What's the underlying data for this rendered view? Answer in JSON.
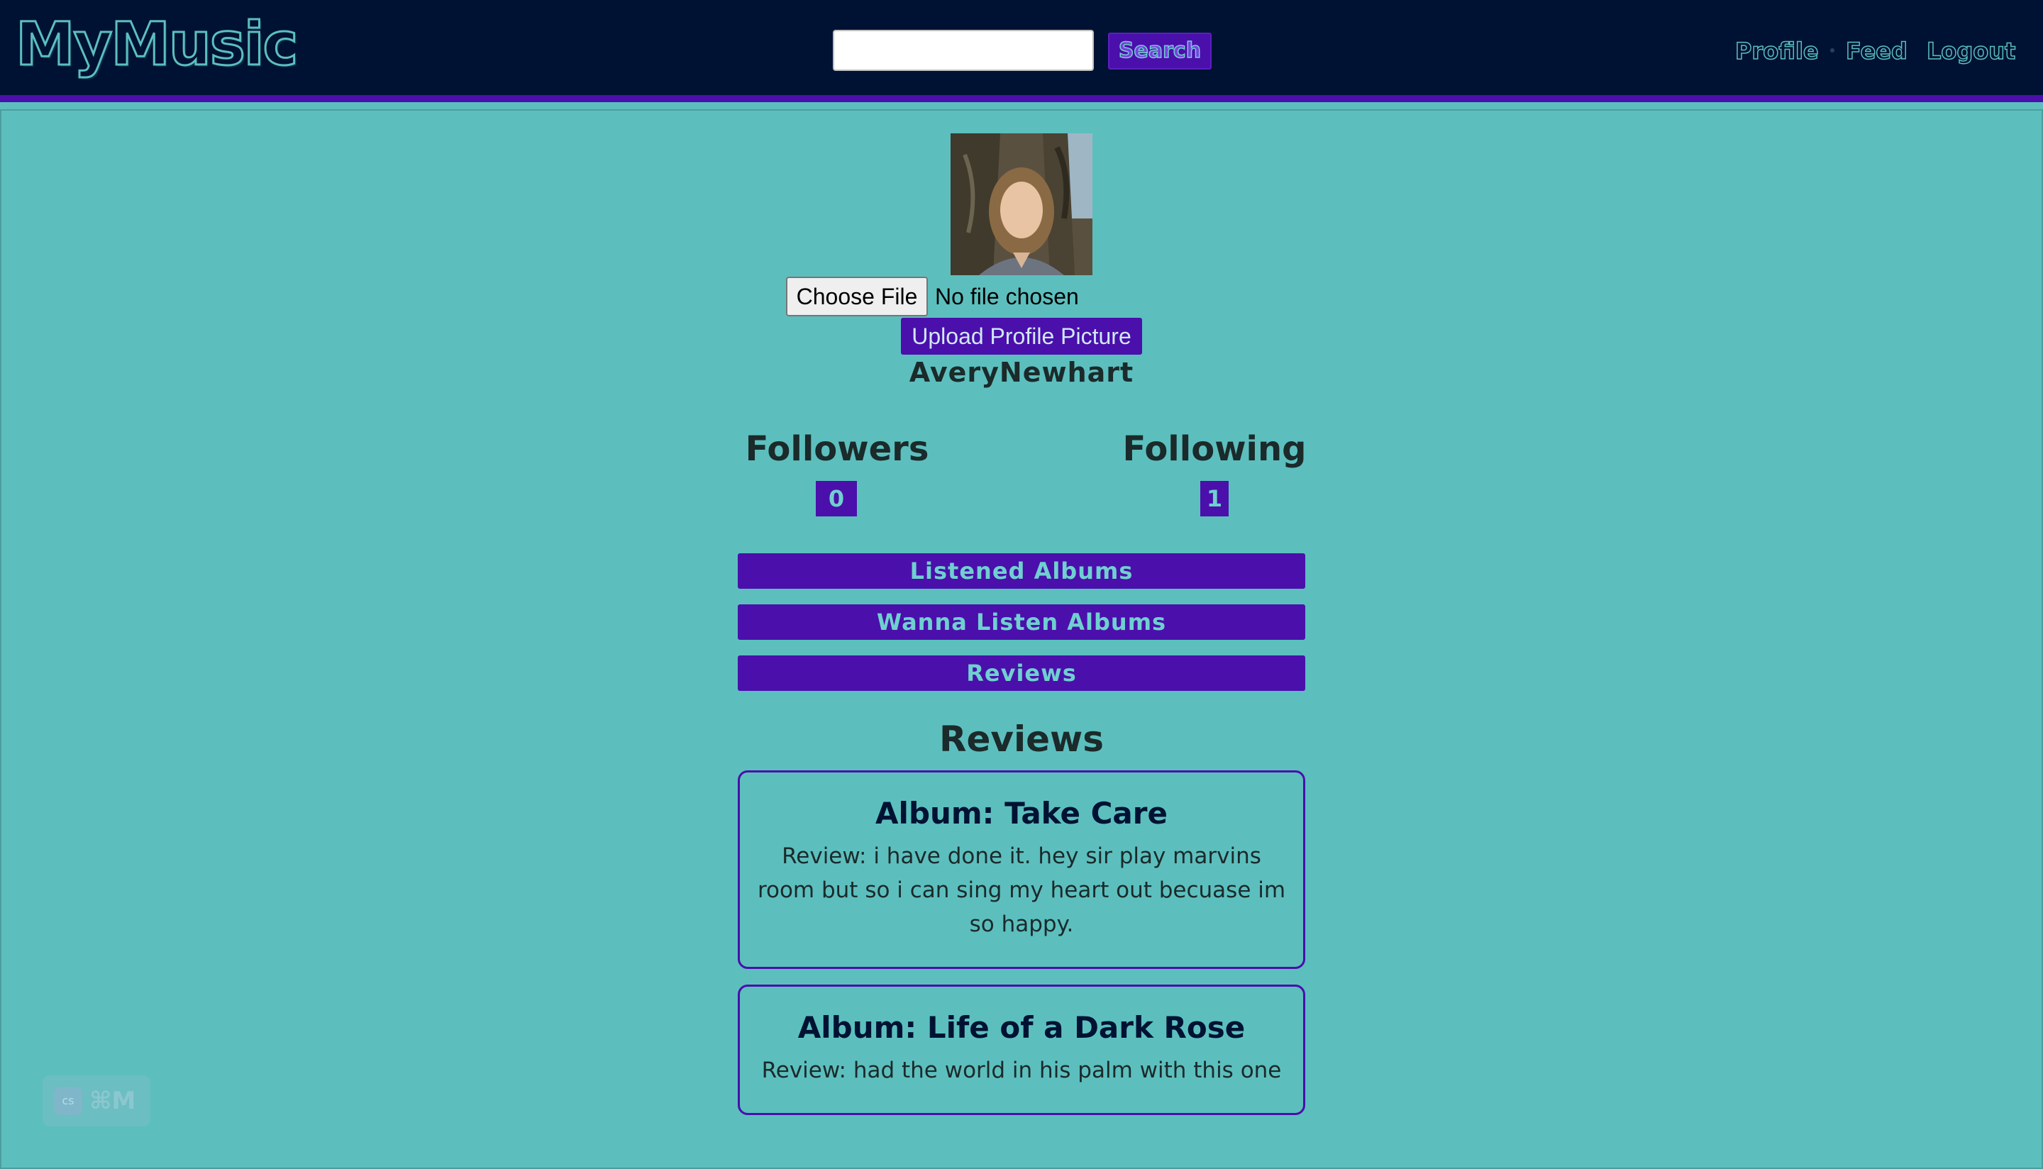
{
  "header": {
    "logo": "MyMusic",
    "search": {
      "value": "",
      "placeholder": "",
      "button_label": "Search"
    },
    "nav": {
      "profile": "Profile",
      "feed": "Feed",
      "logout": "Logout"
    }
  },
  "profile": {
    "avatar_icon": "profile-photo",
    "file_input": {
      "button_label": "Choose File",
      "status": "No file chosen"
    },
    "upload_label": "Upload Profile Picture",
    "username": "AveryNewhart",
    "followers": {
      "label": "Followers",
      "count": "0"
    },
    "following": {
      "label": "Following",
      "count": "1"
    }
  },
  "tabs": [
    "Listened Albums",
    "Wanna Listen Albums",
    "Reviews"
  ],
  "reviews": {
    "title": "Reviews",
    "items": [
      {
        "album": "Album: Take Care",
        "review": "Review: i have done it. hey sir play marvins room but so i can sing my heart out becuase im so happy."
      },
      {
        "album": "Album: Life of a Dark Rose",
        "review": "Review: had the world in his palm with this one"
      }
    ]
  },
  "overlay": {
    "icon": "cs",
    "shortcut": "⌘M"
  },
  "colors": {
    "header_bg": "#001233",
    "accent": "#4b0fab",
    "page_bg": "#5cbfbe",
    "accent_text": "#6fd0cf"
  }
}
